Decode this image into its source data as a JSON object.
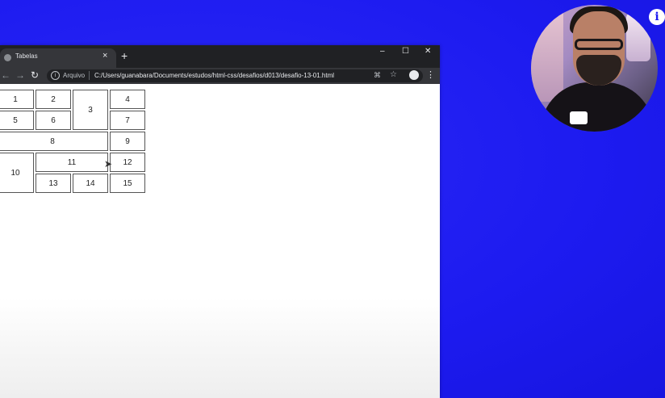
{
  "browser": {
    "tab_title": "Tabelas",
    "tab_close": "×",
    "new_tab": "+",
    "window_controls": {
      "minimize": "–",
      "maximize": "☐",
      "close": "✕"
    },
    "nav": {
      "back": "←",
      "forward": "→",
      "reload": "↻"
    },
    "address": {
      "scheme_label": "Arquivo",
      "url": "C:/Users/guanabara/Documents/estudos/html-css/desafios/d013/desafio-13-01.html"
    },
    "menu": "⋮"
  },
  "table": {
    "rows": [
      [
        "1",
        "2",
        "3",
        "4"
      ],
      [
        "5",
        "6",
        "7"
      ],
      [
        "8",
        "9"
      ],
      [
        "10",
        "11",
        "12"
      ],
      [
        "13",
        "14",
        "15"
      ]
    ]
  },
  "overlay": {
    "info_button": "i"
  }
}
